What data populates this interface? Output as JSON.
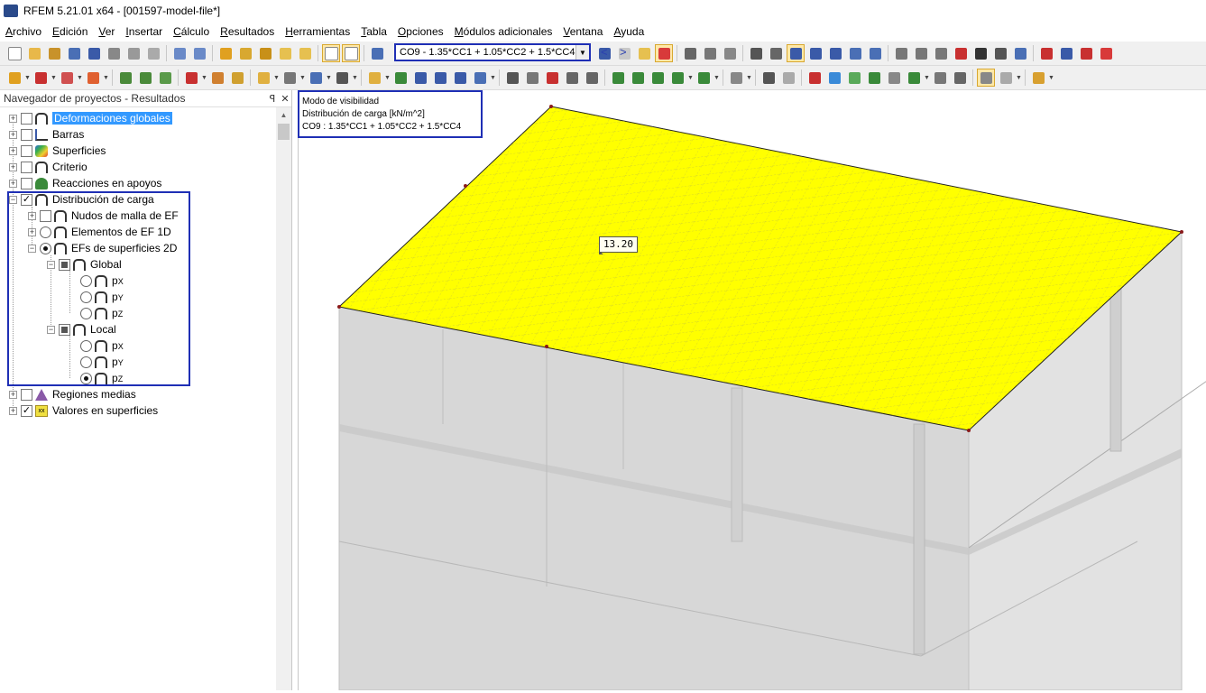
{
  "window": {
    "title": "RFEM 5.21.01 x64 - [001597-model-file*]"
  },
  "menu": [
    {
      "key": "A",
      "rest": "rchivo"
    },
    {
      "key": "E",
      "rest": "dición"
    },
    {
      "key": "V",
      "rest": "er"
    },
    {
      "key": "I",
      "rest": "nsertar"
    },
    {
      "key": "C",
      "rest": "álculo"
    },
    {
      "key": "R",
      "rest": "esultados"
    },
    {
      "key": "H",
      "rest": "erramientas"
    },
    {
      "key": "T",
      "rest": "abla"
    },
    {
      "key": "O",
      "rest": "pciones"
    },
    {
      "key": "M",
      "rest": "ódulos adicionales"
    },
    {
      "key": "V",
      "rest": "entana"
    },
    {
      "key": "A",
      "rest": "yuda"
    }
  ],
  "toolbar": {
    "combo_value": "CO9 - 1.35*CC1 + 1.05*CC2 + 1.5*CC4",
    "prev_glyph": "<",
    "next_glyph": ">"
  },
  "navigator": {
    "title": "Navegador de proyectos - Resultados",
    "pin_glyph": "ꟼ",
    "close_glyph": "✕",
    "items": {
      "deformaciones": "Deformaciones globales",
      "barras": "Barras",
      "superficies": "Superficies",
      "criterio": "Criterio",
      "reacciones": "Reacciones en apoyos",
      "distribucion": "Distribución de carga",
      "nudos": "Nudos de malla de EF",
      "elementos1d": "Elementos de EF 1D",
      "efs2d": "EFs de superficies 2D",
      "global": "Global",
      "local": "Local",
      "regiones": "Regiones medias",
      "valores": "Valores en superficies"
    },
    "components": {
      "base": "p",
      "x": "X",
      "y": "Y",
      "z": "Z"
    }
  },
  "info_panel": {
    "line1": "Modo de visibilidad",
    "line2": "Distribución de carga [kN/m^2]",
    "line3": "CO9 : 1.35*CC1 + 1.05*CC2 + 1.5*CC4"
  },
  "result_label": {
    "value": "13.20"
  },
  "colors": {
    "highlight_border": "#1f2fb5",
    "slab_fill": "#ffff00",
    "mesh_line": "#b5b54a",
    "structure_gray": "#d7d7d7"
  },
  "icons": [
    "new-file-icon",
    "open-icon",
    "save-icon",
    "print-icon",
    "undo-icon",
    "redo-icon",
    "zoom-icon",
    "render-icon",
    "filter-icon",
    "settings-icon"
  ]
}
